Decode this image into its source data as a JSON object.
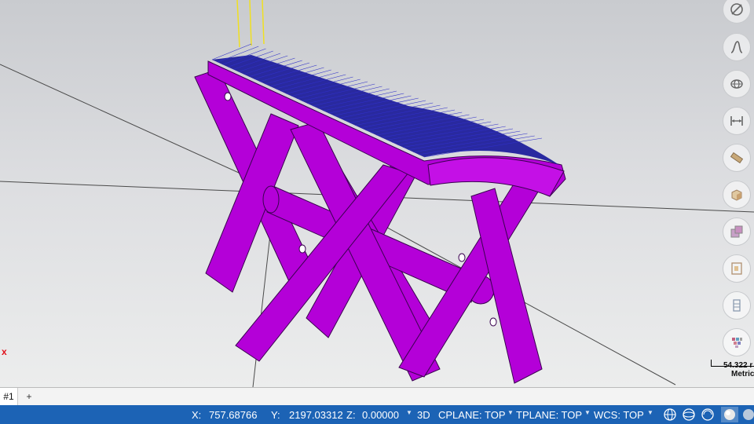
{
  "viewport": {
    "axis_label": "x",
    "model_color": "#b400d8",
    "mesh_color": "#1a1a9a",
    "scale_value": "54.322 r",
    "scale_unit": "Metric"
  },
  "right_toolbar": [
    {
      "icon": "circle-slash-icon"
    },
    {
      "icon": "curve-icon"
    },
    {
      "icon": "wireframe-sphere-icon"
    },
    {
      "icon": "dimension-icon"
    },
    {
      "icon": "transform-icon"
    },
    {
      "icon": "solid-box-icon"
    },
    {
      "icon": "layers-icon"
    },
    {
      "icon": "planes-icon"
    },
    {
      "icon": "levels-icon"
    },
    {
      "icon": "colors-icon"
    }
  ],
  "tabs": {
    "active": "#1",
    "add": "+"
  },
  "status": {
    "x_label": "X:",
    "x_value": "757.68766",
    "y_label": "Y:",
    "y_value": "2197.03312",
    "z_label": "Z:",
    "z_value": "0.00000",
    "mode": "3D",
    "cplane": "CPLANE: TOP",
    "tplane": "TPLANE: TOP",
    "wcs": "WCS: TOP"
  },
  "colors": {
    "statusbar": "#1c63b5",
    "axis_x": "#e0101a"
  }
}
